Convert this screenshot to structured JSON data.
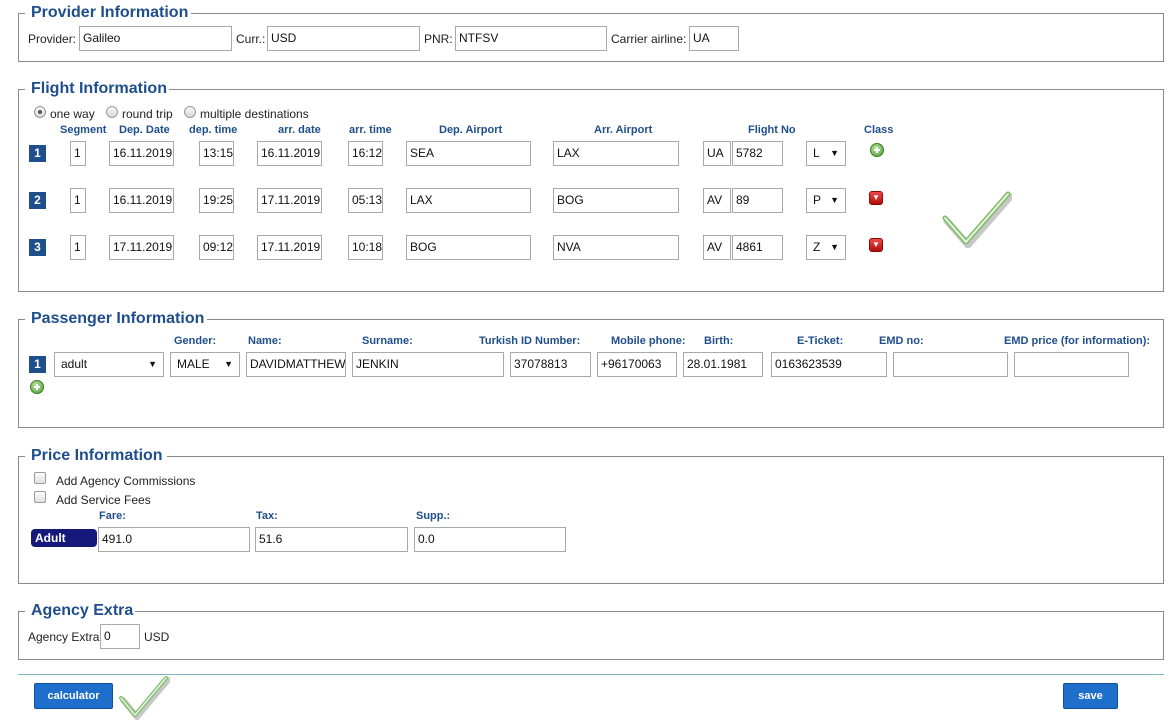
{
  "provider": {
    "title": "Provider Information",
    "provider_label": "Provider:",
    "provider_value": "Galileo",
    "curr_label": "Curr.:",
    "curr_value": "USD",
    "pnr_label": "PNR:",
    "pnr_value": "NTFSV",
    "carrier_label": "Carrier airline:",
    "carrier_value": "UA"
  },
  "flight": {
    "title": "Flight Information",
    "trip_types": [
      {
        "label": "one way",
        "selected": true
      },
      {
        "label": "round trip",
        "selected": false
      },
      {
        "label": "multiple destinations",
        "selected": false
      }
    ],
    "headers": {
      "segment": "Segment",
      "dep_date": "Dep. Date",
      "dep_time": "dep. time",
      "arr_date": "arr. date",
      "arr_time": "arr. time",
      "dep_airport": "Dep. Airport",
      "arr_airport": "Arr. Airport",
      "flight_no": "Flight No",
      "class": "Class"
    },
    "rows": [
      {
        "num": "1",
        "segment": "1",
        "dep_date": "16.11.2019",
        "dep_time": "13:15",
        "arr_date": "16.11.2019",
        "arr_time": "16:12",
        "dep_airport": "SEA",
        "arr_airport": "LAX",
        "airline": "UA",
        "flight_no": "5782",
        "class": "L"
      },
      {
        "num": "2",
        "segment": "1",
        "dep_date": "16.11.2019",
        "dep_time": "19:25",
        "arr_date": "17.11.2019",
        "arr_time": "05:13",
        "dep_airport": "LAX",
        "arr_airport": "BOG",
        "airline": "AV",
        "flight_no": "89",
        "class": "P"
      },
      {
        "num": "3",
        "segment": "1",
        "dep_date": "17.11.2019",
        "dep_time": "09:12",
        "arr_date": "17.11.2019",
        "arr_time": "10:18",
        "dep_airport": "BOG",
        "arr_airport": "NVA",
        "airline": "AV",
        "flight_no": "4861",
        "class": "Z"
      }
    ]
  },
  "passenger": {
    "title": "Passenger Information",
    "headers": {
      "gender": "Gender:",
      "name": "Name:",
      "surname": "Surname:",
      "turkish_id": "Turkish ID Number:",
      "mobile": "Mobile phone:",
      "birth": "Birth:",
      "eticket": "E-Ticket:",
      "emd_no": "EMD no:",
      "emd_price": "EMD price (for information):"
    },
    "row": {
      "num": "1",
      "type": "adult",
      "gender": "MALE",
      "name": "DAVIDMATTHEW",
      "surname": "JENKIN",
      "turkish_id": "37078813",
      "mobile": "+96170063",
      "birth": "28.01.1981",
      "eticket": "0163623539",
      "emd_no": "",
      "emd_price": ""
    }
  },
  "price": {
    "title": "Price Information",
    "agency_commissions_label": "Add Agency Commissions",
    "service_fees_label": "Add Service Fees",
    "fare_label": "Fare:",
    "tax_label": "Tax:",
    "supp_label": "Supp.:",
    "pax_type": "Adult",
    "fare_value": "491.0",
    "tax_value": "51.6",
    "supp_value": "0.0"
  },
  "agency": {
    "title": "Agency Extra",
    "label": "Agency Extra",
    "value": "0",
    "currency": "USD"
  },
  "actions": {
    "calculator_label": "calculator",
    "save_label": "save"
  },
  "colors": {
    "title": "#1f4e8c",
    "button": "#1e6fcc",
    "adult_badge": "#17197a",
    "check": "#7dbb6a"
  }
}
